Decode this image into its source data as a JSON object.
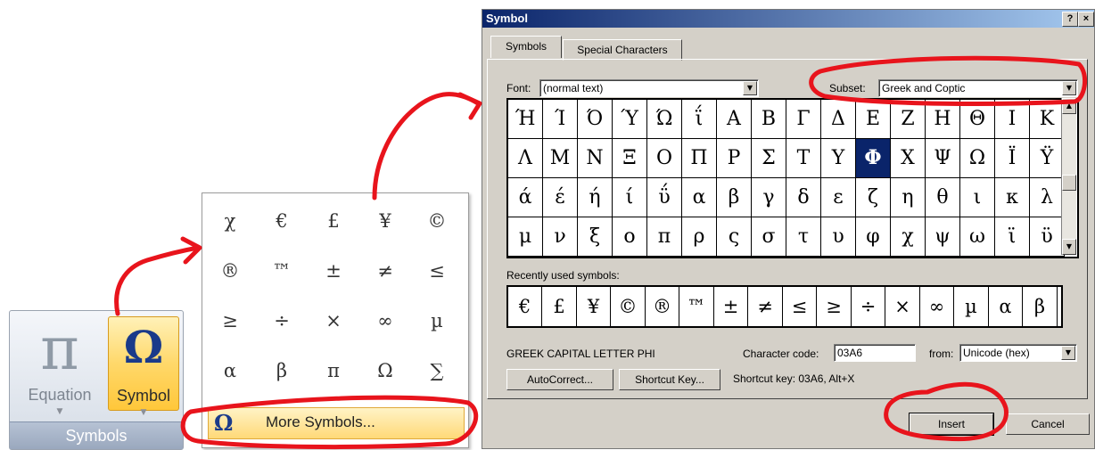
{
  "ribbon": {
    "equation_icon": "pi-icon",
    "equation_label": "Equation",
    "symbol_icon": "omega-icon",
    "symbol_label": "Symbol",
    "group_label": "Symbols"
  },
  "gallery": {
    "symbols": [
      "χ",
      "€",
      "£",
      "¥",
      "©",
      "®",
      "™",
      "±",
      "≠",
      "≤",
      "≥",
      "÷",
      "×",
      "∞",
      "µ",
      "α",
      "β",
      "π",
      "Ω",
      "∑"
    ],
    "more_icon": "Ω",
    "more_label": "More Symbols..."
  },
  "dialog": {
    "title": "Symbol",
    "help_btn": "?",
    "close_btn": "×",
    "tabs": [
      "Symbols",
      "Special Characters"
    ],
    "font_label": "Font:",
    "font_value": "(normal text)",
    "subset_label": "Subset:",
    "subset_value": "Greek and Coptic",
    "symbols": [
      "Ή",
      "Ί",
      "Ό",
      "Ύ",
      "Ώ",
      "ΐ",
      "Α",
      "Β",
      "Γ",
      "Δ",
      "Ε",
      "Ζ",
      "Η",
      "Θ",
      "Ι",
      "Κ",
      "Λ",
      "Μ",
      "Ν",
      "Ξ",
      "Ο",
      "Π",
      "Ρ",
      "Σ",
      "Τ",
      "Υ",
      "Φ",
      "Χ",
      "Ψ",
      "Ω",
      "Ϊ",
      "Ϋ",
      "ά",
      "έ",
      "ή",
      "ί",
      "ΰ",
      "α",
      "β",
      "γ",
      "δ",
      "ε",
      "ζ",
      "η",
      "θ",
      "ι",
      "κ",
      "λ",
      "μ",
      "ν",
      "ξ",
      "ο",
      "π",
      "ρ",
      "ς",
      "σ",
      "τ",
      "υ",
      "φ",
      "χ",
      "ψ",
      "ω",
      "ϊ",
      "ϋ"
    ],
    "selected_symbol": "Φ",
    "recent_label": "Recently used symbols:",
    "recent": [
      "€",
      "£",
      "¥",
      "©",
      "®",
      "™",
      "±",
      "≠",
      "≤",
      "≥",
      "÷",
      "×",
      "∞",
      "µ",
      "α",
      "β"
    ],
    "char_name": "GREEK CAPITAL LETTER PHI",
    "char_code_label": "Character code:",
    "char_code": "03A6",
    "from_label": "from:",
    "from_value": "Unicode (hex)",
    "autocorrect_btn": "AutoCorrect...",
    "shortcut_btn": "Shortcut Key...",
    "shortcut_text": "Shortcut key: 03A6, Alt+X",
    "insert_btn": "Insert",
    "cancel_btn": "Cancel"
  },
  "annotation_color": "#e8141c"
}
